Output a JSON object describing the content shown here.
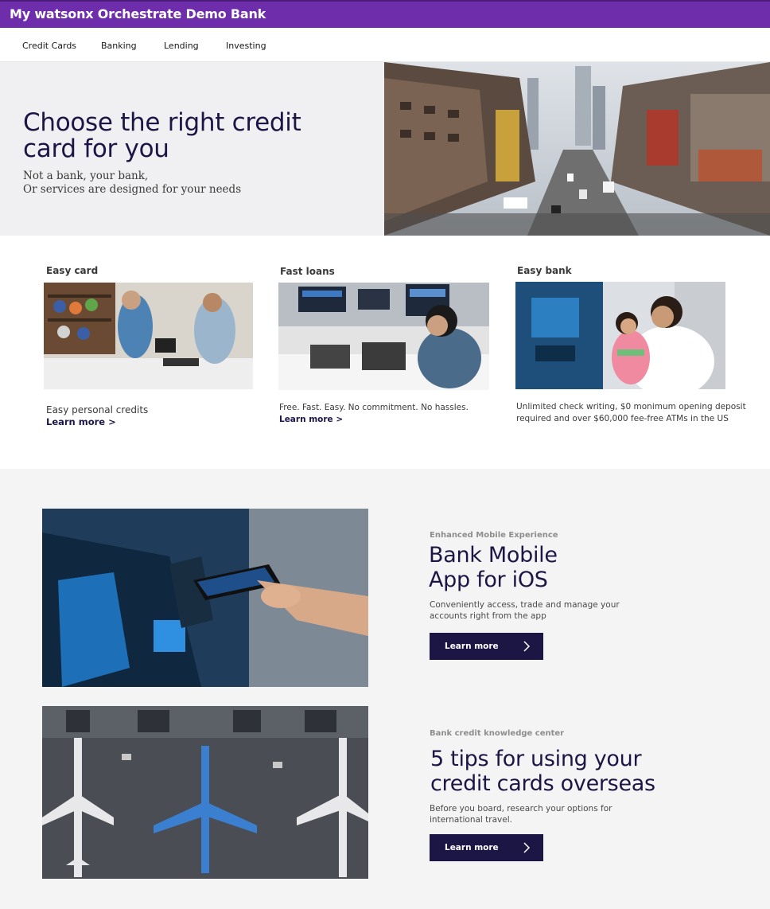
{
  "brand": {
    "title": "My watsonx Orchestrate Demo Bank"
  },
  "nav": {
    "items": [
      {
        "label": "Credit Cards"
      },
      {
        "label": "Banking"
      },
      {
        "label": "Lending"
      },
      {
        "label": "Investing"
      }
    ]
  },
  "hero": {
    "title": "Choose the right credit card for you",
    "subtitle_line1": "Not a bank, your bank,",
    "subtitle_line2": "Or services are designed for your needs"
  },
  "cards": [
    {
      "title": "Easy card",
      "description": "Easy personal credits",
      "link": "Learn more >"
    },
    {
      "title": "Fast loans",
      "description": "Free. Fast. Easy. No commitment. No hassles.",
      "link": "Learn more >"
    },
    {
      "title": "Easy bank",
      "description_line1": "Unlimited check writing, $0 monimum opening deposit",
      "description_line2": "required and over $60,000 fee-free ATMs in the US"
    }
  ],
  "promos": [
    {
      "eyebrow": "Enhanced Mobile Experience",
      "title_line1": "Bank Mobile",
      "title_line2": "App for iOS",
      "desc_line1": "Conveniently access, trade and manage your",
      "desc_line2": "accounts right from the app",
      "button": "Learn more"
    },
    {
      "eyebrow": "Bank credit knowledge center",
      "title_line1": "5 tips for using your",
      "title_line2": "credit cards overseas",
      "desc_line1": "Before you board, research your options for",
      "desc_line2": "international travel.",
      "button": "Learn more"
    }
  ],
  "colors": {
    "brand_purple": "#6e2eab",
    "navy": "#1c1645",
    "hero_bg": "#f0f0f2",
    "promo_bg": "#f4f4f4"
  }
}
